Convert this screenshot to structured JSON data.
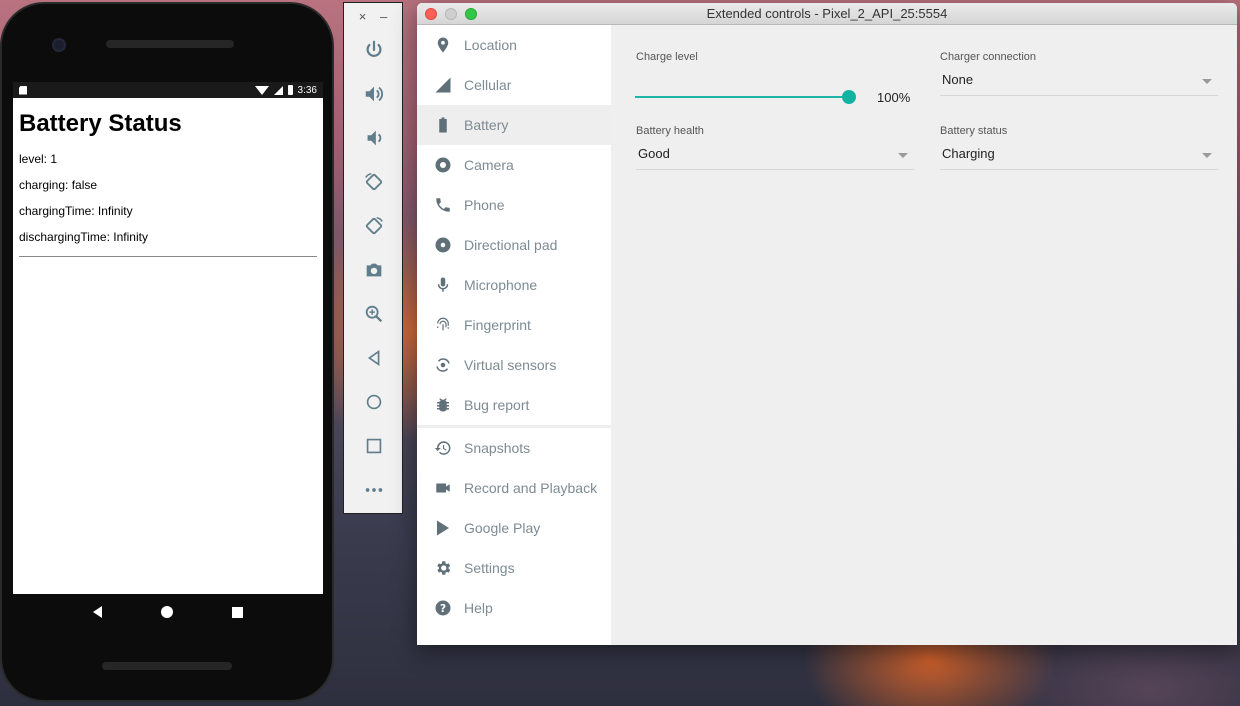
{
  "phone": {
    "status_time": "3:36",
    "app_title": "Battery Status",
    "lines": [
      "level: 1",
      "charging: false",
      "chargingTime: Infinity",
      "dischargingTime: Infinity"
    ]
  },
  "toolbar": {
    "close_label": "×",
    "minimize_label": "–",
    "buttons": [
      {
        "name": "power-icon"
      },
      {
        "name": "volume-up-icon"
      },
      {
        "name": "volume-down-icon"
      },
      {
        "name": "rotate-left-icon"
      },
      {
        "name": "rotate-right-icon"
      },
      {
        "name": "camera-icon"
      },
      {
        "name": "zoom-icon"
      },
      {
        "name": "back-icon"
      },
      {
        "name": "home-icon"
      },
      {
        "name": "overview-icon"
      },
      {
        "name": "more-icon"
      }
    ]
  },
  "window": {
    "title": "Extended controls - Pixel_2_API_25:5554"
  },
  "sidebar": {
    "items": [
      {
        "label": "Location",
        "icon": "location-icon"
      },
      {
        "label": "Cellular",
        "icon": "cellular-icon"
      },
      {
        "label": "Battery",
        "icon": "battery-icon",
        "active": true
      },
      {
        "label": "Camera",
        "icon": "camera-aperture-icon"
      },
      {
        "label": "Phone",
        "icon": "phone-icon"
      },
      {
        "label": "Directional pad",
        "icon": "dpad-icon"
      },
      {
        "label": "Microphone",
        "icon": "microphone-icon"
      },
      {
        "label": "Fingerprint",
        "icon": "fingerprint-icon"
      },
      {
        "label": "Virtual sensors",
        "icon": "sensors-icon"
      },
      {
        "label": "Bug report",
        "icon": "bug-icon"
      }
    ],
    "items2": [
      {
        "label": "Snapshots",
        "icon": "history-icon"
      },
      {
        "label": "Record and Playback",
        "icon": "video-icon"
      },
      {
        "label": "Google Play",
        "icon": "play-icon"
      },
      {
        "label": "Settings",
        "icon": "gear-icon"
      },
      {
        "label": "Help",
        "icon": "help-icon"
      }
    ]
  },
  "battery": {
    "charge_level_label": "Charge level",
    "charge_level_value": "100%",
    "charge_level_fraction": 1.0,
    "charger_connection_label": "Charger connection",
    "charger_connection_value": "None",
    "battery_health_label": "Battery health",
    "battery_health_value": "Good",
    "battery_status_label": "Battery status",
    "battery_status_value": "Charging"
  },
  "colors": {
    "accent": "#12b3a0",
    "sidebar_text": "#7d8b93"
  }
}
